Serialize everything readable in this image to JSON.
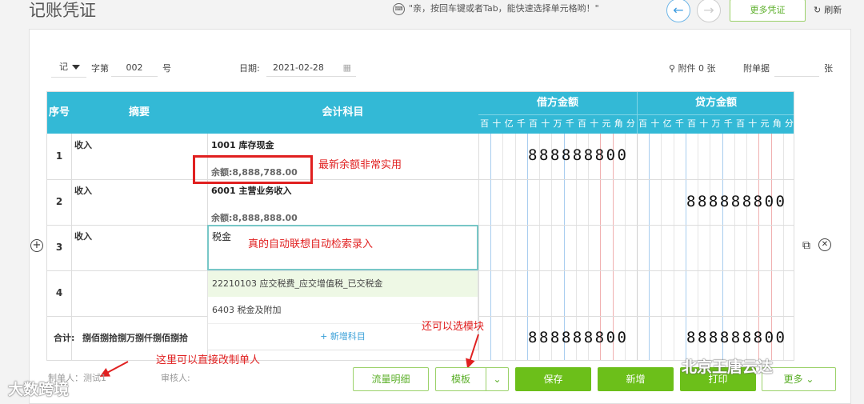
{
  "header": {
    "title": "记账凭证",
    "tip": "\"亲，按回车键或者Tab，能快速选择单元格哟！\"",
    "keyboard_icon": "keyboard-icon",
    "prev_icon": "←",
    "next_icon": "→",
    "more_voucher": "更多凭证",
    "refresh": "刷新",
    "refresh_icon": "↻"
  },
  "meta": {
    "word": "记",
    "word_label": "字第",
    "number": "002",
    "number_unit": "号",
    "date_label": "日期:",
    "date": "2021-02-28",
    "attachment": "附件 0 张",
    "attach_doc_label": "附单据",
    "attach_doc_unit": "张"
  },
  "table": {
    "headers": {
      "seq": "序号",
      "summary": "摘要",
      "subject": "会计科目",
      "debit": "借方金额",
      "credit": "贷方金额"
    },
    "digit_units": [
      "百",
      "十",
      "亿",
      "千",
      "百",
      "十",
      "万",
      "千",
      "百",
      "十",
      "元",
      "角",
      "分"
    ],
    "rows": [
      {
        "seq": "1",
        "summary": "收入",
        "subject": "1001 库存现金",
        "balance": "余额:8,888,788.00",
        "debit": "888888800",
        "credit": ""
      },
      {
        "seq": "2",
        "summary": "收入",
        "subject": "6001 主营业务收入",
        "balance": "余额:8,888,888.00",
        "debit": "",
        "credit": "888888800"
      },
      {
        "seq": "3",
        "summary": "收入",
        "subject_input": "税金",
        "debit": "",
        "credit": ""
      },
      {
        "seq": "4",
        "summary": "",
        "debit": "",
        "credit": ""
      }
    ],
    "suggestions": [
      "22210103 应交税费_应交增值税_已交税金",
      "6403 税金及附加"
    ],
    "add_subject": "+ 新增科目",
    "total_label": "合计:",
    "total_words": "捌佰捌拾捌万捌仟捌佰捌拾",
    "total_debit": "888888800",
    "total_credit": "888888800"
  },
  "footer": {
    "preparer": "制单人：测试1",
    "reviewer": "审核人:",
    "buttons": {
      "flow": "流量明细",
      "template": "模板",
      "save": "保存",
      "new": "新增",
      "print": "打印",
      "more": "更多"
    }
  },
  "annotations": {
    "balance_note": "最新余额非常实用",
    "auto_note": "真的自动联想自动检索录入",
    "template_note": "还可以选模块",
    "preparer_note": "这里可以直接改制单人"
  },
  "watermarks": {
    "left": "大数跨境",
    "right": "北京王唐云达"
  },
  "colors": {
    "header_bg": "#33b9d6",
    "accent_green": "#6cbf1a",
    "annotation_red": "#e02020"
  }
}
